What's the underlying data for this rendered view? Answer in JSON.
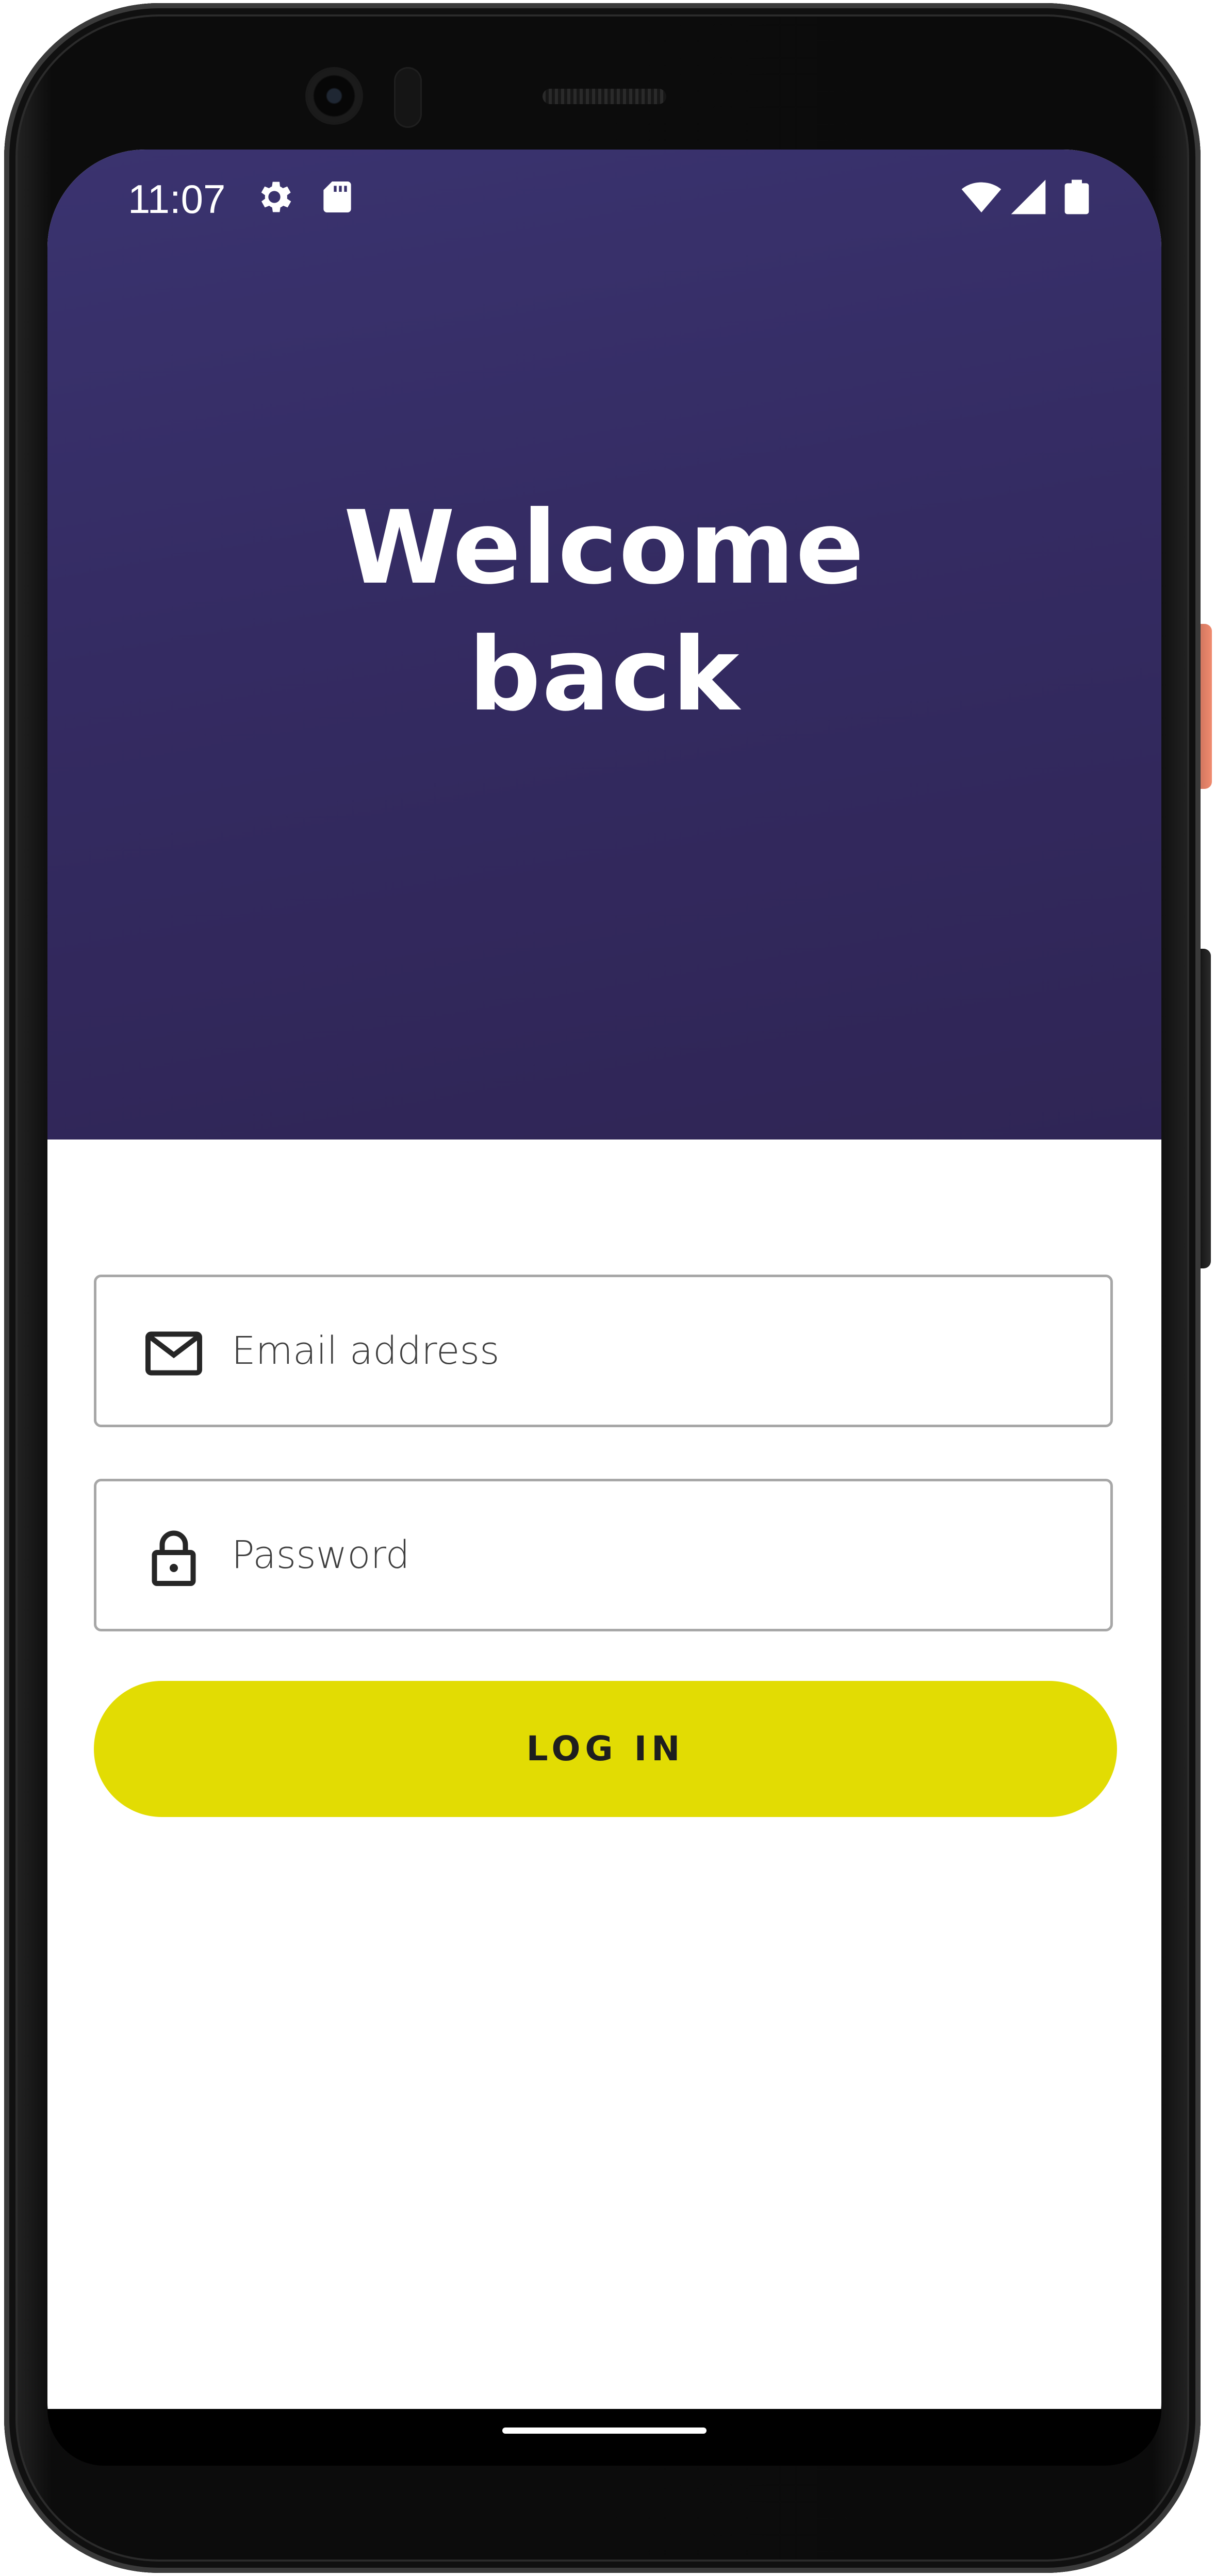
{
  "status_bar": {
    "time": "11:07",
    "left_icons": [
      "gear-icon",
      "sd-card-icon"
    ],
    "right_icons": [
      "wifi-icon",
      "cell-signal-icon",
      "battery-icon"
    ]
  },
  "header": {
    "title_line1": "Welcome",
    "title_line2": "back"
  },
  "form": {
    "email": {
      "icon": "envelope-icon",
      "placeholder": "Email address",
      "value": ""
    },
    "password": {
      "icon": "lock-icon",
      "placeholder": "Password",
      "value": ""
    },
    "login_label": "LOG IN"
  },
  "colors": {
    "header_background": "#342b62",
    "button_accent": "#e2dc03",
    "field_border": "#a7a7a7",
    "text_on_dark": "#ffffff"
  }
}
